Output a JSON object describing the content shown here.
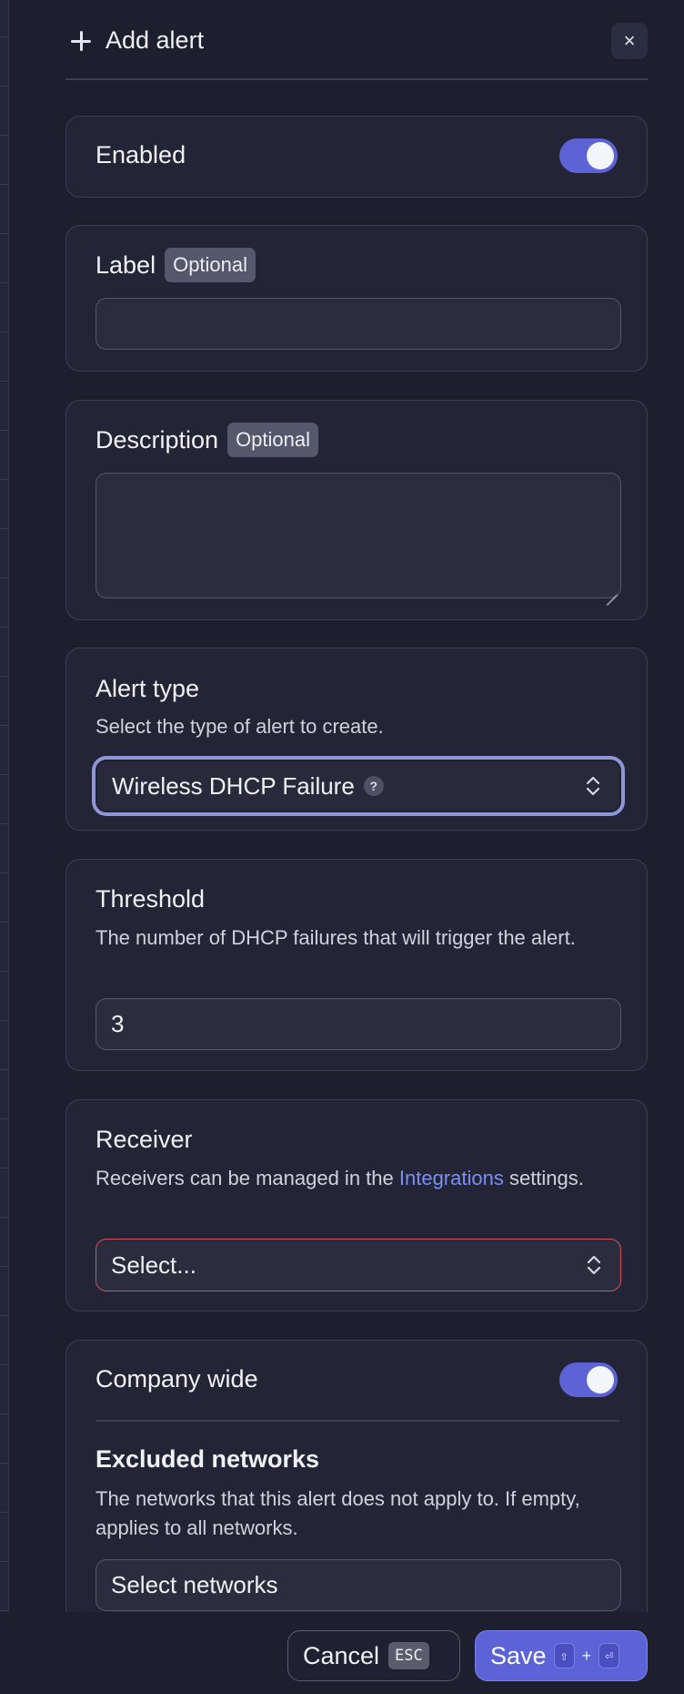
{
  "header": {
    "title": "Add alert",
    "close_label": "×"
  },
  "enabled": {
    "label": "Enabled",
    "on": true
  },
  "label_field": {
    "label": "Label",
    "badge": "Optional",
    "value": ""
  },
  "description_field": {
    "label": "Description",
    "badge": "Optional",
    "value": ""
  },
  "alert_type": {
    "label": "Alert type",
    "help": "Select the type of alert to create.",
    "selected": "Wireless DHCP Failure",
    "help_icon": "?"
  },
  "threshold": {
    "label": "Threshold",
    "help": "The number of DHCP failures that will trigger the alert.",
    "value": "3"
  },
  "receiver": {
    "label": "Receiver",
    "help_prefix": "Receivers can be managed in the ",
    "help_link": "Integrations",
    "help_suffix": " settings.",
    "placeholder": "Select..."
  },
  "company_wide": {
    "label": "Company wide",
    "on": true
  },
  "excluded_networks": {
    "label": "Excluded networks",
    "help": "The networks that this alert does not apply to. If empty, applies to all networks.",
    "placeholder": "Select networks"
  },
  "footer": {
    "cancel_label": "Cancel",
    "cancel_key": "ESC",
    "save_label": "Save",
    "save_key_shift": "⇧",
    "save_key_plus": "+",
    "save_key_enter": "⏎"
  },
  "colors": {
    "accent": "#5c63d6",
    "error": "#d4525c",
    "link": "#7c8ff0"
  }
}
